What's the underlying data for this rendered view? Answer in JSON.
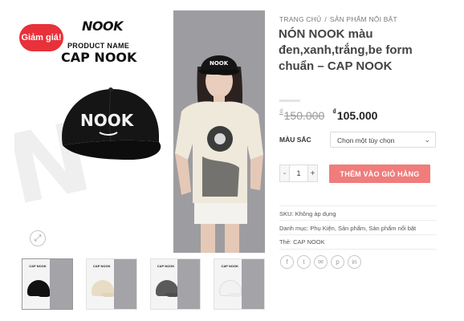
{
  "gallery": {
    "sale_badge": "Giảm giá!",
    "brand_logo": "NOOK",
    "product_name_label": "PRODUCT NAME",
    "product_code": "CAP NOOK",
    "cap_logo": "NOOK",
    "model_cap_logo": "NOOK",
    "zoom_icon": "expand-icon"
  },
  "thumbnails": [
    {
      "label": "NOOK\nPRODUCT NAME\nCAP NOOK",
      "cap_color": "#111111"
    },
    {
      "label": "NOOK\nPRODUCT NAME\nCAP NOOK",
      "cap_color": "#e8dcc4"
    },
    {
      "label": "NOOK\nPRODUCT NAME\nCAP NOOK",
      "cap_color": "#5a5a5a"
    },
    {
      "label": "NOOK\nPRODUCT NAME\nCAP NOOK",
      "cap_color": "#f2f2f2"
    }
  ],
  "breadcrumb": {
    "home": "TRANG CHỦ",
    "separator": "/",
    "category": "SẢN PHẨM NỔI BẬT"
  },
  "product": {
    "title": "NÓN NOOK màu đen,xanh,trắng,be form chuẩn – CAP NOOK",
    "old_price": "150.000",
    "new_price": "105.000",
    "currency_symbol": "₫"
  },
  "options": {
    "color_label": "MÀU SẮC",
    "color_selected": "Chọn một tùy chọn"
  },
  "cart": {
    "minus": "-",
    "quantity": "1",
    "plus": "+",
    "add_to_cart": "THÊM VÀO GIỎ HÀNG"
  },
  "meta": {
    "sku_label": "SKU:",
    "sku_value": "Không áp dụng",
    "category_label": "Danh mục:",
    "category_value": "Phụ Kiện, Sản phẩm, Sản phẩm nổi bật",
    "tag_label": "Thẻ:",
    "tag_value": "CAP NOOK"
  },
  "share_icons": [
    "facebook-icon",
    "twitter-icon",
    "email-icon",
    "pinterest-icon",
    "linkedin-icon"
  ],
  "colors": {
    "sale_red": "#e8313b",
    "cart_button": "#f07c7c",
    "title_text": "#444444"
  }
}
